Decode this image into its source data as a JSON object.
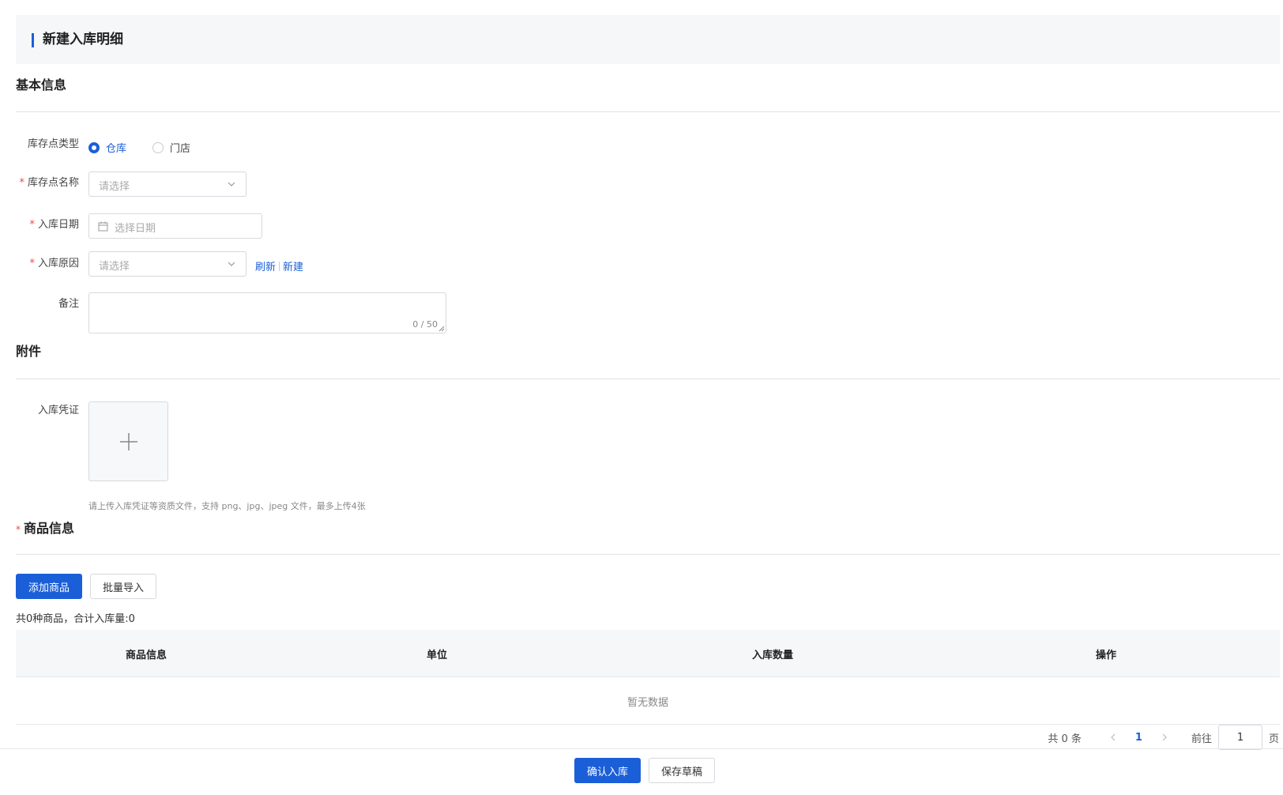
{
  "header": {
    "title": "新建入库明细"
  },
  "basic": {
    "title": "基本信息",
    "type_label": "库存点类型",
    "type_options": [
      "仓库",
      "门店"
    ],
    "type_selected": "仓库",
    "name_label": "库存点名称",
    "name_placeholder": "请选择",
    "date_label": "入库日期",
    "date_placeholder": "选择日期",
    "reason_label": "入库原因",
    "reason_placeholder": "请选择",
    "refresh_link": "刷新",
    "new_link": "新建",
    "remark_label": "备注",
    "remark_count": "0 / 50",
    "required_mark": "*"
  },
  "attachment": {
    "title": "附件",
    "voucher_label": "入库凭证",
    "hint": "请上传入库凭证等资质文件，支持 png、jpg、jpeg 文件，最多上传4张"
  },
  "goods": {
    "title": "商品信息",
    "add_button": "添加商品",
    "import_button": "批量导入",
    "summary": "共0种商品，合计入库量:0",
    "columns": [
      "商品信息",
      "单位",
      "入库数量",
      "操作"
    ],
    "empty_text": "暂无数据"
  },
  "pagination": {
    "total": "共 0 条",
    "current": "1",
    "goto_label": "前往",
    "page_input": "1",
    "page_suffix": "页"
  },
  "footer": {
    "confirm_button": "确认入库",
    "draft_button": "保存草稿"
  },
  "colors": {
    "primary": "#1b5fd8",
    "required": "#e64b4b"
  }
}
